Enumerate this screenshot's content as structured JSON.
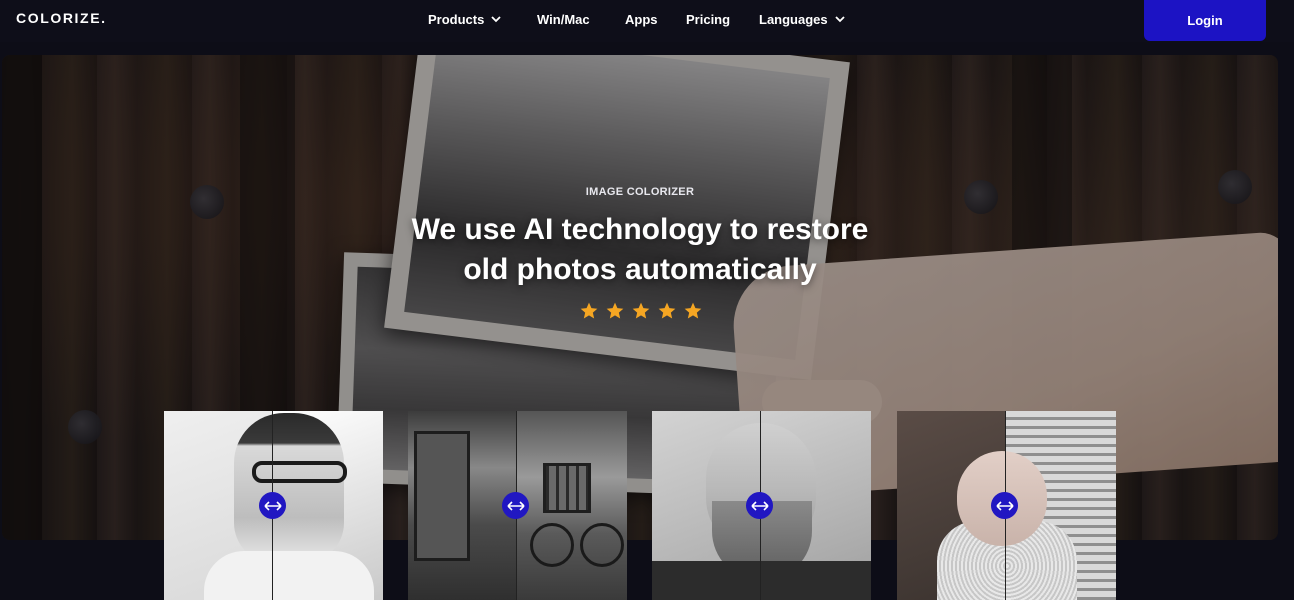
{
  "nav": {
    "logo": "COLORIZE.",
    "items": [
      {
        "label": "Products",
        "has_dropdown": true
      },
      {
        "label": "Win/Mac",
        "has_dropdown": false
      },
      {
        "label": "Apps",
        "has_dropdown": false
      },
      {
        "label": "Pricing",
        "has_dropdown": false
      },
      {
        "label": "Languages",
        "has_dropdown": true
      }
    ],
    "login_label": "Login"
  },
  "hero": {
    "eyebrow": "IMAGE COLORIZER",
    "headline_line1": "We use AI technology to restore",
    "headline_line2": "old photos automatically",
    "rating_stars": 5
  },
  "comparisons": [
    {
      "subject": "man with glasses portrait"
    },
    {
      "subject": "street with bicycle and graffiti"
    },
    {
      "subject": "bearded elderly man portrait"
    },
    {
      "subject": "smiling baby portrait"
    }
  ],
  "colors": {
    "background": "#0d0d17",
    "accent": "#1c13c4",
    "star": "#f5a623"
  }
}
